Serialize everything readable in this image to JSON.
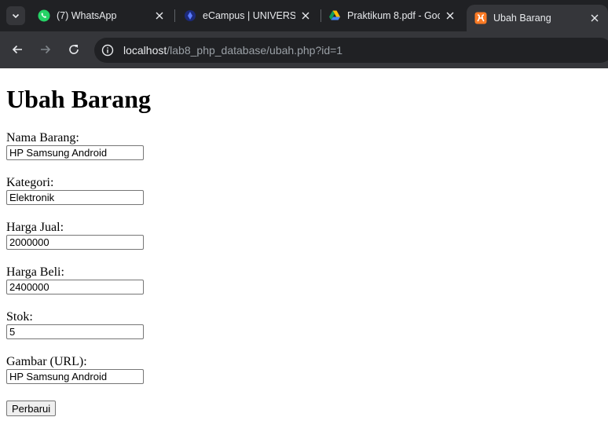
{
  "browser": {
    "tabs": [
      {
        "title": "(7) WhatsApp",
        "icon": "whatsapp-icon",
        "active": false
      },
      {
        "title": "eCampus | UNIVERSIT",
        "icon": "ecampus-icon",
        "active": false
      },
      {
        "title": "Praktikum 8.pdf - Goo",
        "icon": "google-drive-icon",
        "active": false
      },
      {
        "title": "Ubah Barang",
        "icon": "xampp-icon",
        "active": true
      }
    ],
    "url": {
      "host": "localhost",
      "path": "/lab8_php_database/ubah.php?id=1"
    },
    "colors": {
      "tabstrip": "#202124",
      "toolbar": "#35363a",
      "omnibox": "#202124",
      "whatsapp": "#25d366",
      "xampp": "#fb7a24"
    }
  },
  "page": {
    "heading": "Ubah Barang",
    "fields": [
      {
        "label": "Nama Barang:",
        "value": "HP Samsung Android"
      },
      {
        "label": "Kategori:",
        "value": "Elektronik"
      },
      {
        "label": "Harga Jual:",
        "value": "2000000"
      },
      {
        "label": "Harga Beli:",
        "value": "2400000"
      },
      {
        "label": "Stok:",
        "value": "5"
      },
      {
        "label": "Gambar (URL):",
        "value": "HP Samsung Android"
      }
    ],
    "submit_label": "Perbarui"
  }
}
